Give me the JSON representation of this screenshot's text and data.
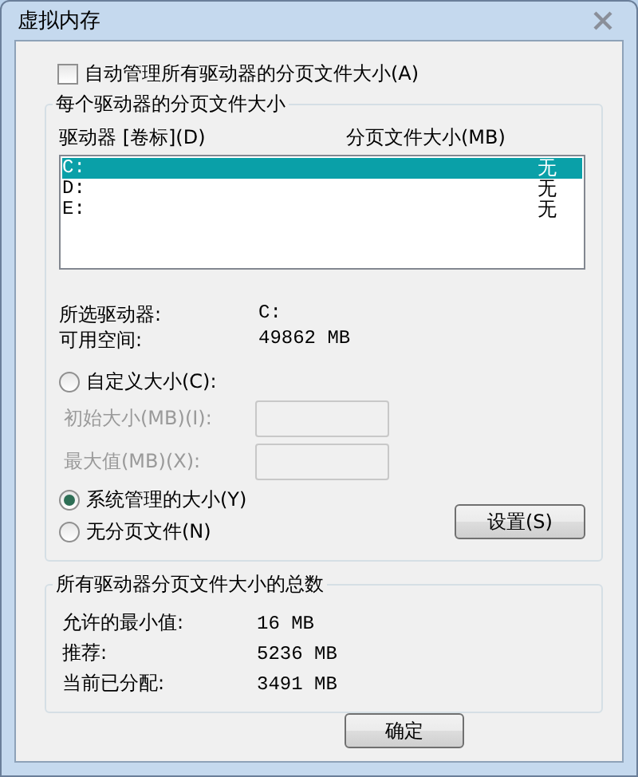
{
  "window": {
    "title": "虚拟内存"
  },
  "auto_manage": {
    "label": "自动管理所有驱动器的分页文件大小(A)",
    "checked": false
  },
  "per_drive": {
    "title": "每个驱动器的分页文件大小",
    "columns": [
      "驱动器 [卷标](D)",
      "分页文件大小(MB)"
    ],
    "drives": [
      {
        "drive": "C:",
        "size": "无",
        "selected": true
      },
      {
        "drive": "D:",
        "size": "无",
        "selected": false
      },
      {
        "drive": "E:",
        "size": "无",
        "selected": false
      }
    ],
    "info": [
      {
        "label": "所选驱动器:",
        "value": "C:"
      },
      {
        "label": "可用空间:",
        "value": "49862 MB"
      }
    ],
    "options": [
      {
        "label": "自定义大小(C):",
        "selected": false,
        "fields": [
          {
            "label": "初始大小(MB)(I):",
            "disabled": true
          },
          {
            "label": "最大值(MB)(X):",
            "disabled": true
          }
        ]
      },
      {
        "label": "系统管理的大小(Y)",
        "selected": true
      },
      {
        "label": "无分页文件(N)",
        "selected": false
      }
    ],
    "set_button": "设置(S)"
  },
  "totals": {
    "title": "所有驱动器分页文件大小的总数",
    "rows": [
      {
        "label": "允许的最小值:",
        "value": "16 MB"
      },
      {
        "label": "推荐:",
        "value": "5236 MB"
      },
      {
        "label": "当前已分配:",
        "value": "3491 MB"
      }
    ]
  },
  "buttons": [
    "确定"
  ]
}
